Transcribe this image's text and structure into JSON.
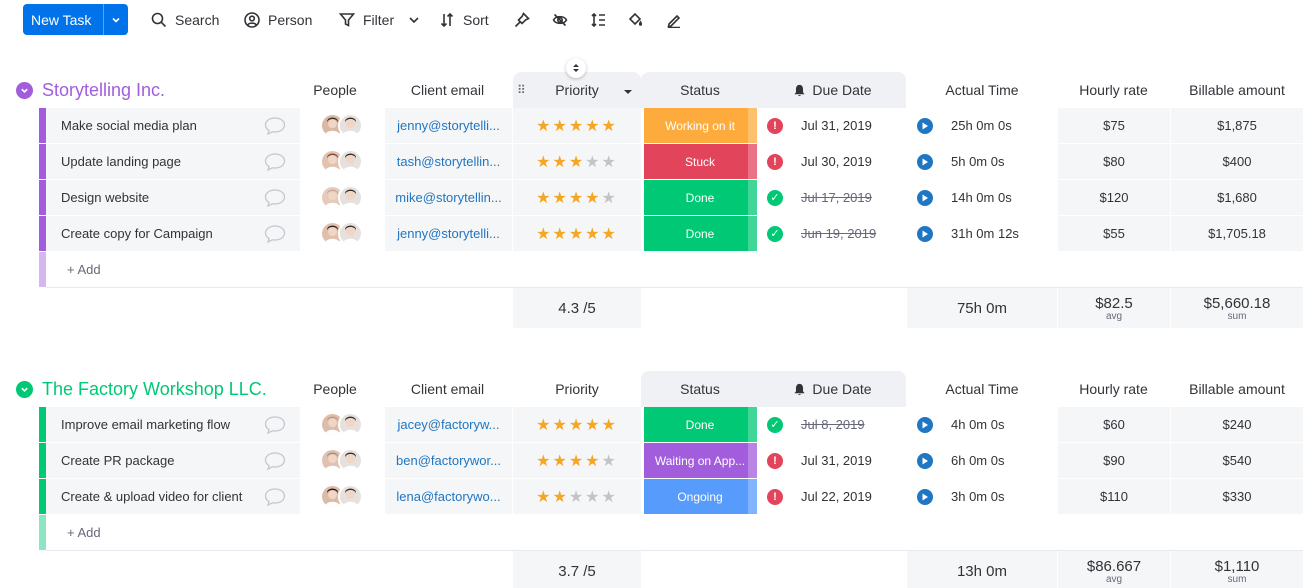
{
  "toolbar": {
    "new_task": "New Task",
    "search": "Search",
    "person": "Person",
    "filter": "Filter",
    "sort": "Sort"
  },
  "columns": {
    "people": "People",
    "client_email": "Client email",
    "priority": "Priority",
    "status": "Status",
    "due_date": "Due Date",
    "actual_time": "Actual Time",
    "hourly_rate": "Hourly rate",
    "billable_amount": "Billable amount"
  },
  "colors": {
    "accent": "#0073ea",
    "group1": "#a25ddc",
    "group2": "#00c875",
    "working": "#fdab3d",
    "stuck": "#e2445c",
    "done": "#00c875",
    "waiting": "#a25ddc",
    "ongoing": "#579bfc",
    "star": "#f5a623"
  },
  "add_label": "+ Add",
  "groups": [
    {
      "title": "Storytelling Inc.",
      "rows": [
        {
          "name": "Make social media plan",
          "email": "jenny@storytelli...",
          "stars": 5,
          "status": "Working on it",
          "status_color": "#fdab3d",
          "due_icon": "alert",
          "due": "Jul 31, 2019",
          "due_strike": false,
          "time": "25h 0m 0s",
          "rate": "$75",
          "amount": "$1,875"
        },
        {
          "name": "Update landing page",
          "email": "tash@storytellin...",
          "stars": 3,
          "status": "Stuck",
          "status_color": "#e2445c",
          "due_icon": "alert",
          "due": "Jul 30, 2019",
          "due_strike": false,
          "time": "5h 0m 0s",
          "rate": "$80",
          "amount": "$400"
        },
        {
          "name": "Design website",
          "email": "mike@storytellin...",
          "stars": 4,
          "status": "Done",
          "status_color": "#00c875",
          "due_icon": "check",
          "due": "Jul 17, 2019",
          "due_strike": true,
          "time": "14h 0m 0s",
          "rate": "$120",
          "amount": "$1,680"
        },
        {
          "name": "Create copy for Campaign",
          "email": "jenny@storytelli...",
          "stars": 5,
          "status": "Done",
          "status_color": "#00c875",
          "due_icon": "check",
          "due": "Jun 19, 2019",
          "due_strike": true,
          "time": "31h 0m 12s",
          "rate": "$55",
          "amount": "$1,705.18"
        }
      ],
      "summary": {
        "priority": "4.3 /5",
        "time": "75h 0m",
        "rate": "$82.5",
        "rate_sub": "avg",
        "amount": "$5,660.18",
        "amount_sub": "sum"
      }
    },
    {
      "title": "The Factory Workshop LLC.",
      "rows": [
        {
          "name": "Improve email marketing flow",
          "email": "jacey@factoryw...",
          "stars": 5,
          "status": "Done",
          "status_color": "#00c875",
          "due_icon": "check",
          "due": "Jul 8, 2019",
          "due_strike": true,
          "time": "4h 0m 0s",
          "rate": "$60",
          "amount": "$240"
        },
        {
          "name": "Create PR package",
          "email": "ben@factorywor...",
          "stars": 4,
          "status": "Waiting on App...",
          "status_color": "#a25ddc",
          "due_icon": "alert",
          "due": "Jul 31, 2019",
          "due_strike": false,
          "time": "6h 0m 0s",
          "rate": "$90",
          "amount": "$540"
        },
        {
          "name": "Create & upload video for client",
          "email": "lena@factorywo...",
          "stars": 2,
          "status": "Ongoing",
          "status_color": "#579bfc",
          "due_icon": "alert",
          "due": "Jul 22, 2019",
          "due_strike": false,
          "time": "3h 0m 0s",
          "rate": "$110",
          "amount": "$330"
        }
      ],
      "summary": {
        "priority": "3.7 /5",
        "time": "13h 0m",
        "rate": "$86.667",
        "rate_sub": "avg",
        "amount": "$1,110",
        "amount_sub": "sum"
      }
    }
  ]
}
